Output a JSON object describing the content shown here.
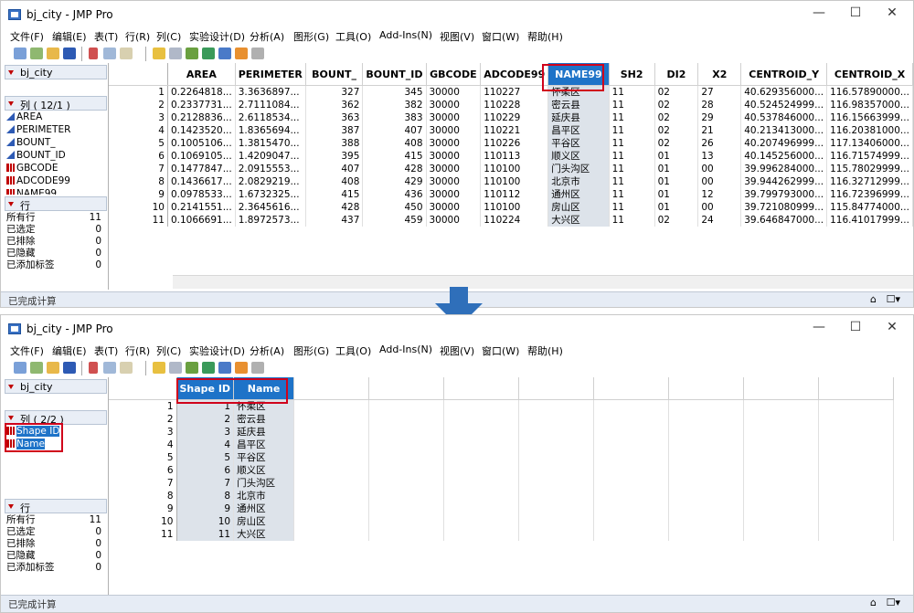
{
  "window_title": "bj_city - JMP Pro",
  "menu": [
    "文件(F)",
    "编辑(E)",
    "表(T)",
    "行(R)",
    "列(C)",
    "实验设计(D)",
    "分析(A)",
    "图形(G)",
    "工具(O)",
    "Add-Ins(N)",
    "视图(V)",
    "窗口(W)",
    "帮助(H)"
  ],
  "window_controls": {
    "minimize": "—",
    "maximize": "☐",
    "close": "✕"
  },
  "table_name": "bj_city",
  "status": "已完成计算",
  "row_stats_header": "行",
  "row_stats": [
    {
      "label": "所有行",
      "value": "11"
    },
    {
      "label": "已选定",
      "value": "0"
    },
    {
      "label": "已排除",
      "value": "0"
    },
    {
      "label": "已隐藏",
      "value": "0"
    },
    {
      "label": "已添加标签",
      "value": "0"
    }
  ],
  "before": {
    "columns_header": "列 ( 12/1 )",
    "column_list": [
      {
        "name": "AREA",
        "type": "continuous"
      },
      {
        "name": "PERIMETER",
        "type": "continuous"
      },
      {
        "name": "BOUNT_",
        "type": "continuous"
      },
      {
        "name": "BOUNT_ID",
        "type": "continuous"
      },
      {
        "name": "GBCODE",
        "type": "nominal"
      },
      {
        "name": "ADCODE99",
        "type": "nominal"
      },
      {
        "name": "NAME99",
        "type": "nominal"
      }
    ],
    "headers": [
      "AREA",
      "PERIMETER",
      "BOUNT_",
      "BOUNT_ID",
      "GBCODE",
      "ADCODE99",
      "NAME99",
      "SH2",
      "DI2",
      "X2",
      "CENTROID_Y",
      "CENTROID_X"
    ],
    "rows": [
      [
        "1",
        "0.2264818...",
        "3.3636897...",
        "327",
        "345",
        "30000",
        "110227",
        "怀柔区",
        "11",
        "02",
        "27",
        "40.629356000...",
        "116.57890000..."
      ],
      [
        "2",
        "0.2337731...",
        "2.7111084...",
        "362",
        "382",
        "30000",
        "110228",
        "密云县",
        "11",
        "02",
        "28",
        "40.524524999...",
        "116.98357000..."
      ],
      [
        "3",
        "0.2128836...",
        "2.6118534...",
        "363",
        "383",
        "30000",
        "110229",
        "延庆县",
        "11",
        "02",
        "29",
        "40.537846000...",
        "116.15663999..."
      ],
      [
        "4",
        "0.1423520...",
        "1.8365694...",
        "387",
        "407",
        "30000",
        "110221",
        "昌平区",
        "11",
        "02",
        "21",
        "40.213413000...",
        "116.20381000..."
      ],
      [
        "5",
        "0.1005106...",
        "1.3815470...",
        "388",
        "408",
        "30000",
        "110226",
        "平谷区",
        "11",
        "02",
        "26",
        "40.207496999...",
        "117.13406000..."
      ],
      [
        "6",
        "0.1069105...",
        "1.4209047...",
        "395",
        "415",
        "30000",
        "110113",
        "顺义区",
        "11",
        "01",
        "13",
        "40.145256000...",
        "116.71574999..."
      ],
      [
        "7",
        "0.1477847...",
        "2.0915553...",
        "407",
        "428",
        "30000",
        "110100",
        "门头沟区",
        "11",
        "01",
        "00",
        "39.996284000...",
        "115.78029999..."
      ],
      [
        "8",
        "0.1436617...",
        "2.0829219...",
        "408",
        "429",
        "30000",
        "110100",
        "北京市",
        "11",
        "01",
        "00",
        "39.944262999...",
        "116.32712999..."
      ],
      [
        "9",
        "0.0978533...",
        "1.6732325...",
        "415",
        "436",
        "30000",
        "110112",
        "通州区",
        "11",
        "01",
        "12",
        "39.799793000...",
        "116.72396999..."
      ],
      [
        "10",
        "0.2141551...",
        "2.3645616...",
        "428",
        "450",
        "30000",
        "110100",
        "房山区",
        "11",
        "01",
        "00",
        "39.721080999...",
        "115.84774000..."
      ],
      [
        "11",
        "0.1066691...",
        "1.8972573...",
        "437",
        "459",
        "30000",
        "110224",
        "大兴区",
        "11",
        "02",
        "24",
        "39.646847000...",
        "116.41017999..."
      ]
    ]
  },
  "after": {
    "columns_header": "列 ( 2/2 )",
    "column_list": [
      {
        "name": "Shape ID",
        "type": "nominal"
      },
      {
        "name": "Name",
        "type": "nominal"
      }
    ],
    "headers": [
      "Shape ID",
      "Name"
    ],
    "rows": [
      [
        "1",
        "1",
        "怀柔区"
      ],
      [
        "2",
        "2",
        "密云县"
      ],
      [
        "3",
        "3",
        "延庆县"
      ],
      [
        "4",
        "4",
        "昌平区"
      ],
      [
        "5",
        "5",
        "平谷区"
      ],
      [
        "6",
        "6",
        "顺义区"
      ],
      [
        "7",
        "7",
        "门头沟区"
      ],
      [
        "8",
        "8",
        "北京市"
      ],
      [
        "9",
        "9",
        "通州区"
      ],
      [
        "10",
        "10",
        "房山区"
      ],
      [
        "11",
        "11",
        "大兴区"
      ]
    ]
  },
  "colors": {
    "selected_header": "#1e73c8",
    "highlight_box": "#d0021b",
    "arrow": "#2f6fba"
  }
}
